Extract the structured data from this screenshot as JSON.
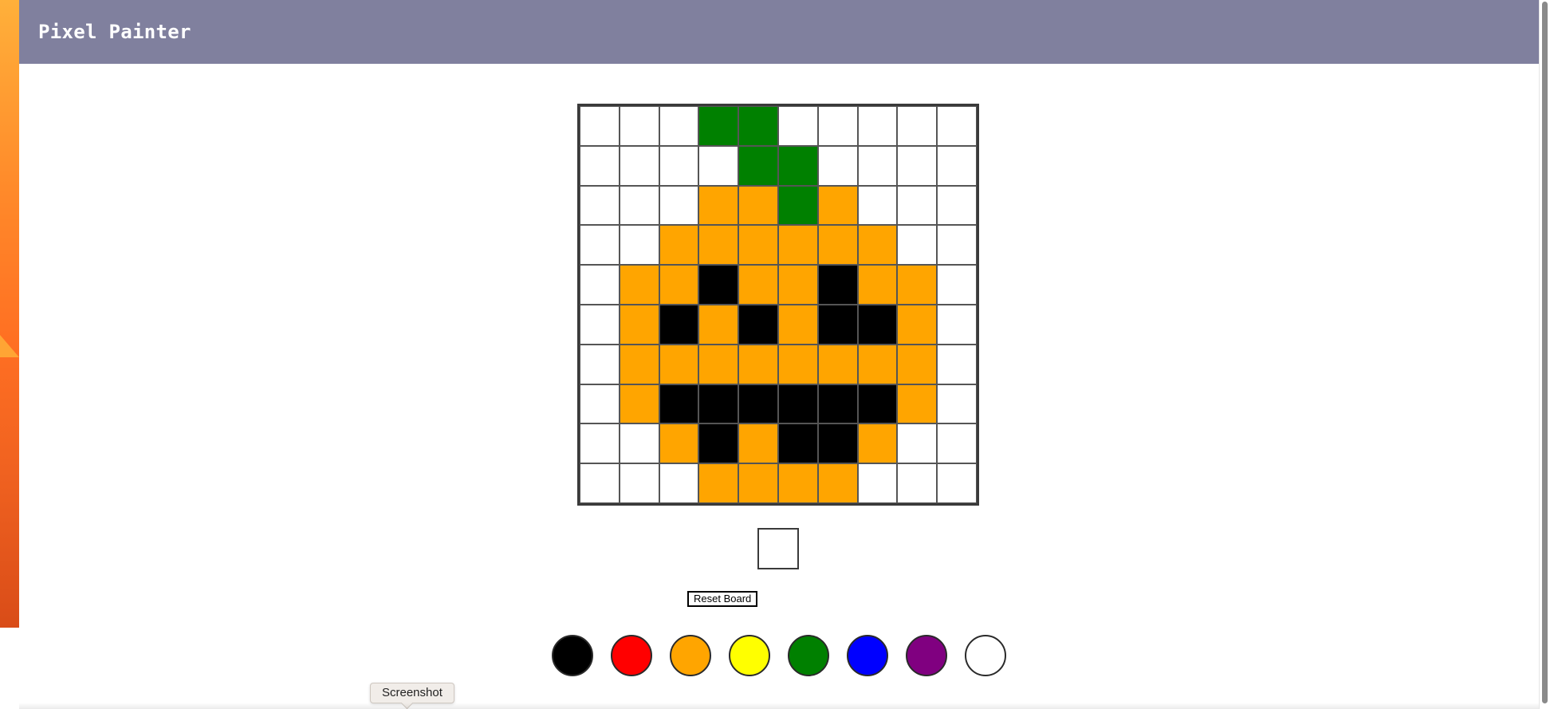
{
  "app": {
    "title": "Pixel Painter"
  },
  "colors": {
    "header_bg": "#80809e",
    "header_text": "#ffffff"
  },
  "palette_map": {
    "W": "#ffffff",
    "G": "#008000",
    "O": "#ffa500",
    "K": "#000000"
  },
  "board": {
    "rows": [
      "WWWGGWWWWW",
      "WWWWGGWWWW",
      "WWWOOGOWWW",
      "WWOOOOOOWW",
      "WOOKOOKOOW",
      "WOKOKOKKOW",
      "WOOOOOOOOW",
      "WOKKKKKKOW",
      "WWOKOKKOWW",
      "WWWOOOOWWW"
    ]
  },
  "current_color": "#ffffff",
  "controls": {
    "reset_label": "Reset Board"
  },
  "palette": [
    {
      "name": "black",
      "color": "#000000"
    },
    {
      "name": "red",
      "color": "#ff0000"
    },
    {
      "name": "orange",
      "color": "#ffa500"
    },
    {
      "name": "yellow",
      "color": "#ffff00"
    },
    {
      "name": "green",
      "color": "#008000"
    },
    {
      "name": "blue",
      "color": "#0000ff"
    },
    {
      "name": "purple",
      "color": "#800080"
    },
    {
      "name": "white",
      "color": "#ffffff"
    }
  ],
  "tooltip": {
    "label": "Screenshot"
  }
}
